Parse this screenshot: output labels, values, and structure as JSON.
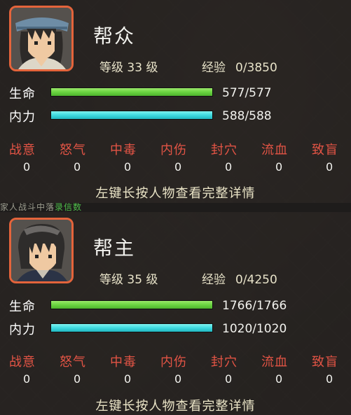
{
  "background_strip_text": "家人战斗中落",
  "background_strip_green": "录信数",
  "characters": [
    {
      "name": "帮众",
      "level_label": "等级",
      "level_value": "33",
      "level_unit": "级",
      "exp_label": "经验",
      "exp_value": "0/3850",
      "hp_label": "生命",
      "hp_value": "577/577",
      "hp_fill": 1.0,
      "mp_label": "内力",
      "mp_value": "588/588",
      "mp_fill": 1.0,
      "statuses": [
        {
          "label": "战意",
          "value": "0"
        },
        {
          "label": "怒气",
          "value": "0"
        },
        {
          "label": "中毒",
          "value": "0"
        },
        {
          "label": "内伤",
          "value": "0"
        },
        {
          "label": "封穴",
          "value": "0"
        },
        {
          "label": "流血",
          "value": "0"
        },
        {
          "label": "致盲",
          "value": "0"
        }
      ],
      "hint": "左键长按人物查看完整详情"
    },
    {
      "name": "帮主",
      "level_label": "等级",
      "level_value": "35",
      "level_unit": "级",
      "exp_label": "经验",
      "exp_value": "0/4250",
      "hp_label": "生命",
      "hp_value": "1766/1766",
      "hp_fill": 1.0,
      "mp_label": "内力",
      "mp_value": "1020/1020",
      "mp_fill": 1.0,
      "statuses": [
        {
          "label": "战意",
          "value": "0"
        },
        {
          "label": "怒气",
          "value": "0"
        },
        {
          "label": "中毒",
          "value": "0"
        },
        {
          "label": "内伤",
          "value": "0"
        },
        {
          "label": "封穴",
          "value": "0"
        },
        {
          "label": "流血",
          "value": "0"
        },
        {
          "label": "致盲",
          "value": "0"
        }
      ],
      "hint": "左键长按人物查看完整详情"
    }
  ],
  "colors": {
    "portrait_border": "#e4643b",
    "hp_bar": "#6ad441",
    "mp_bar": "#3fdbe0",
    "status_label": "#e35445"
  }
}
